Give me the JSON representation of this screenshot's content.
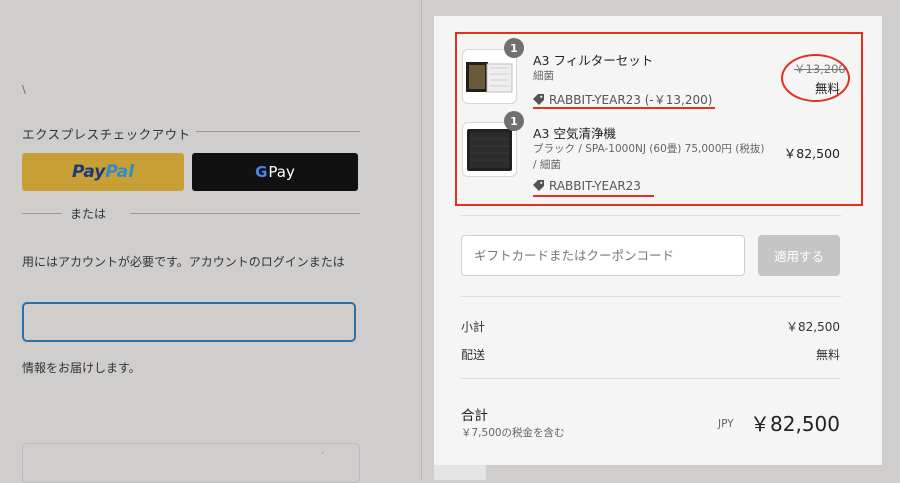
{
  "left": {
    "stray_char": "\\",
    "express_checkout_title": "エクスプレスチェックアウト",
    "paypal": {
      "part1": "Pay",
      "part2": "Pal"
    },
    "gpay": {
      "g": "G",
      "label": "Pay"
    },
    "or_text": "または",
    "account_note": "用にはアカウントが必要です。アカウントのログインまたは",
    "email_note": "情報をお届けします。",
    "tick": "ˊ"
  },
  "summary": {
    "items": [
      {
        "quantity": "1",
        "title": "A3 フィルターセット",
        "subtitle_line1": "細菌",
        "subtitle_line2": "",
        "discount_code": "RABBIT-YEAR23 (-￥13,200)",
        "original_price": "￥13,200",
        "price": "無料",
        "icon": "filter-set-image"
      },
      {
        "quantity": "1",
        "title": "A3 空気清浄機",
        "subtitle_line1": "ブラック / SPA-1000NJ (60畳) 75,000円 (税抜)",
        "subtitle_line2": "/ 細菌",
        "discount_code": "RABBIT-YEAR23",
        "original_price": "",
        "price": "￥82,500",
        "icon": "air-purifier-image"
      }
    ],
    "coupon": {
      "placeholder": "ギフトカードまたはクーポンコード",
      "value": "",
      "apply_label": "適用する"
    },
    "subtotal": {
      "label": "小計",
      "value": "￥82,500"
    },
    "shipping": {
      "label": "配送",
      "value": "無料"
    },
    "total": {
      "label": "合計",
      "tax_note": "￥7,500の税金を含む",
      "currency": "JPY",
      "value": "￥82,500"
    }
  },
  "colors": {
    "highlight": "#e0321f",
    "paypal_bg": "#c79f35",
    "gpay_bg": "#111111",
    "email_border": "#2f6fa8",
    "apply_btn": "#c5c5c5"
  }
}
